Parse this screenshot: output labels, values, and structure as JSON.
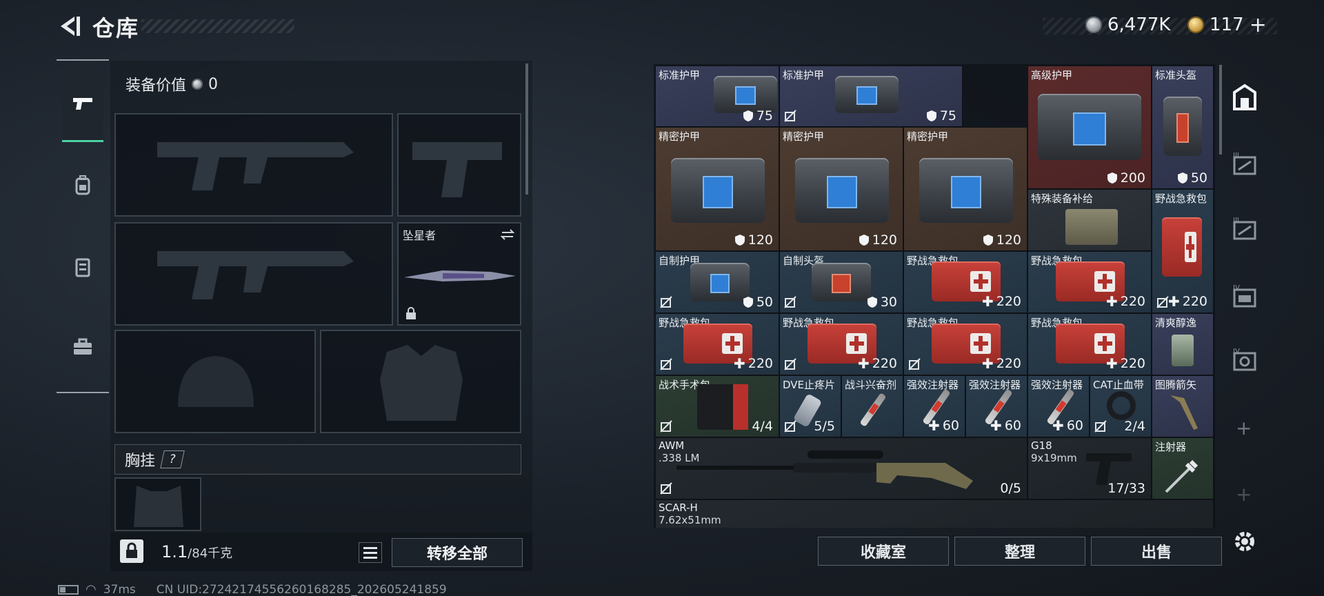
{
  "header": {
    "title": "仓库",
    "currency_silver": "6,477K",
    "currency_gold": "117",
    "gold_add": "+"
  },
  "loadout": {
    "equip_value_label": "装备价值",
    "equip_value": "0",
    "melee_name": "坠星者",
    "chest_rig_label": "胸挂",
    "help": "?",
    "weight_current": "1.1",
    "weight_max": "/84千克",
    "transfer_all": "转移全部"
  },
  "storage": {
    "items": [
      {
        "name": "标准护甲",
        "value": "75"
      },
      {
        "name": "标准护甲",
        "value": "75"
      },
      {
        "name": "高级护甲",
        "value": "200"
      },
      {
        "name": "标准头盔",
        "value": "50"
      },
      {
        "name": "精密护甲",
        "value": "120"
      },
      {
        "name": "精密护甲",
        "value": "120"
      },
      {
        "name": "精密护甲",
        "value": "120"
      },
      {
        "name": "特殊装备补给",
        "value": ""
      },
      {
        "name": "野战急救包",
        "value": "220"
      },
      {
        "name": "自制护甲",
        "value": "50"
      },
      {
        "name": "自制头盔",
        "value": "30"
      },
      {
        "name": "野战急救包",
        "value": "220"
      },
      {
        "name": "野战急救包",
        "value": "220"
      },
      {
        "name": "野战急救包",
        "value": "220"
      },
      {
        "name": "野战急救包",
        "value": "220"
      },
      {
        "name": "野战急救包",
        "value": "220"
      },
      {
        "name": "野战急救包",
        "value": "220"
      },
      {
        "name": "清爽醇逸",
        "value": ""
      },
      {
        "name": "战术手术包",
        "value": "4/4"
      },
      {
        "name": "DVE止疼片",
        "value": "5/5"
      },
      {
        "name": "战斗兴奋剂",
        "value": ""
      },
      {
        "name": "强效注射器",
        "value": "60"
      },
      {
        "name": "强效注射器",
        "value": "60"
      },
      {
        "name": "强效注射器",
        "value": "60"
      },
      {
        "name": "CAT止血带",
        "value": "2/4"
      },
      {
        "name": "图腾箭矢",
        "value": ""
      },
      {
        "name": "AWM",
        "sub": ".338 LM",
        "value": "0/5"
      },
      {
        "name": "G18",
        "sub": "9x19mm",
        "value": "17/33"
      },
      {
        "name": "注射器",
        "value": ""
      },
      {
        "name": "SCAR-H",
        "sub": "7.62x51mm",
        "value": ""
      }
    ]
  },
  "actions": {
    "collection": "收藏室",
    "organize": "整理",
    "sell": "出售"
  },
  "status": {
    "ping": "37ms",
    "uid": "CN UID:27242174556260168285_202605241859"
  },
  "side_tabs": {
    "add": "+"
  }
}
